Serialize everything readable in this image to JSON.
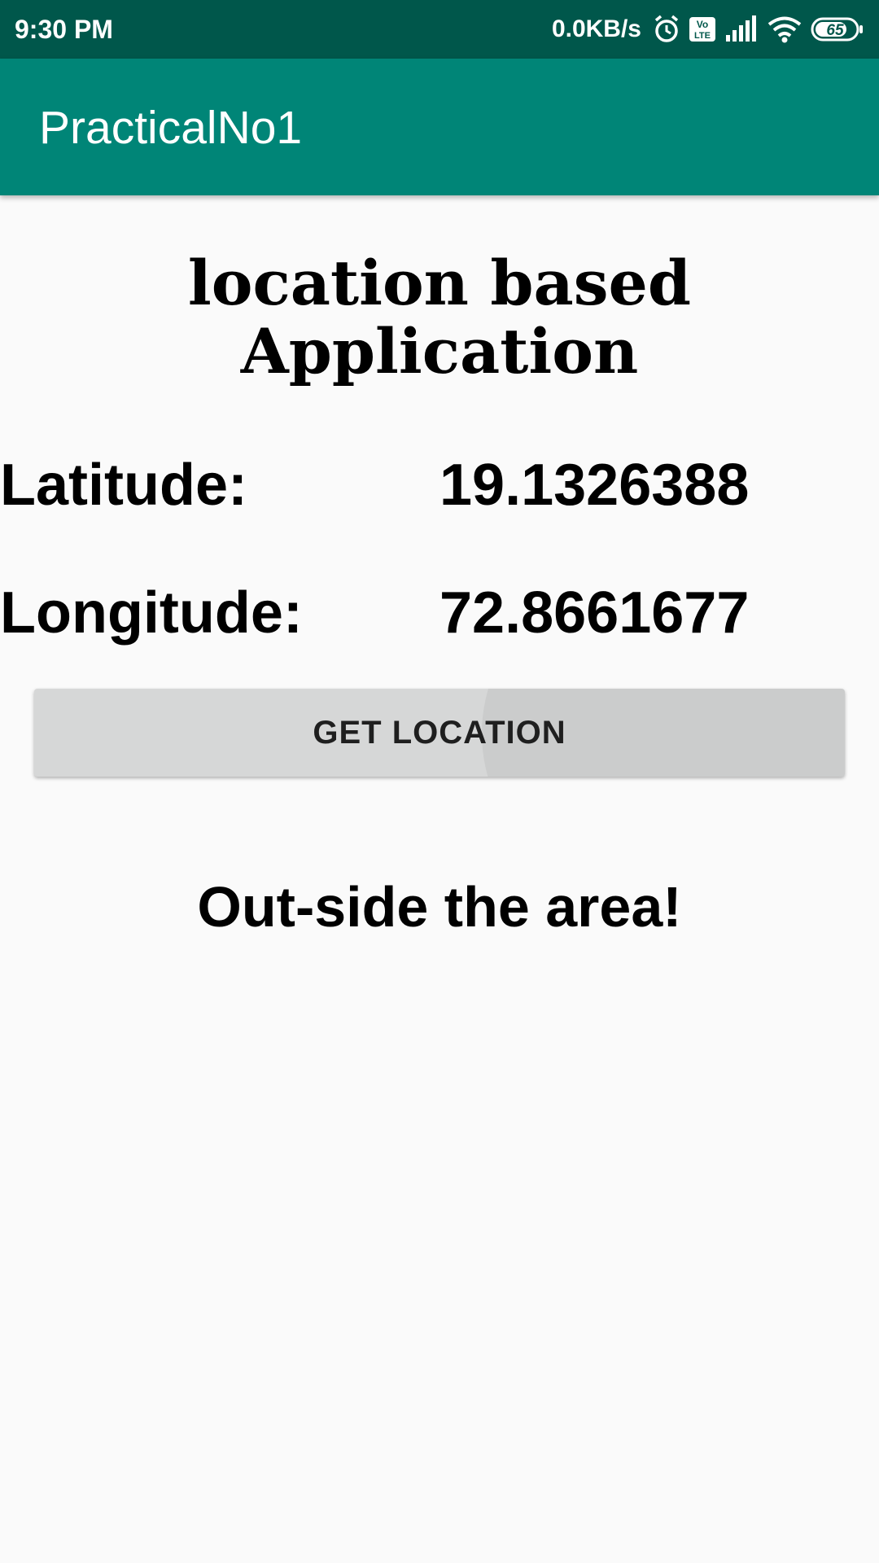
{
  "status_bar": {
    "time": "9:30 PM",
    "network_speed": "0.0KB/s",
    "battery": "65",
    "volte_label": "Vo LTE",
    "icons": [
      "alarm-icon",
      "volte-icon",
      "signal-icon",
      "wifi-icon",
      "battery-icon"
    ]
  },
  "app_bar": {
    "title": "PracticalNo1"
  },
  "main": {
    "heading_line1": "location based",
    "heading_line2": "Application",
    "latitude_label": "Latitude:",
    "latitude_value": "19.1326388",
    "longitude_label": "Longitude:",
    "longitude_value": "72.8661677",
    "get_location_label": "GET LOCATION",
    "status_message": "Out-side the area!"
  },
  "colors": {
    "status_bar": "#00574b",
    "app_bar": "#008577",
    "background": "#fafafa",
    "button": "#d6d7d7"
  }
}
